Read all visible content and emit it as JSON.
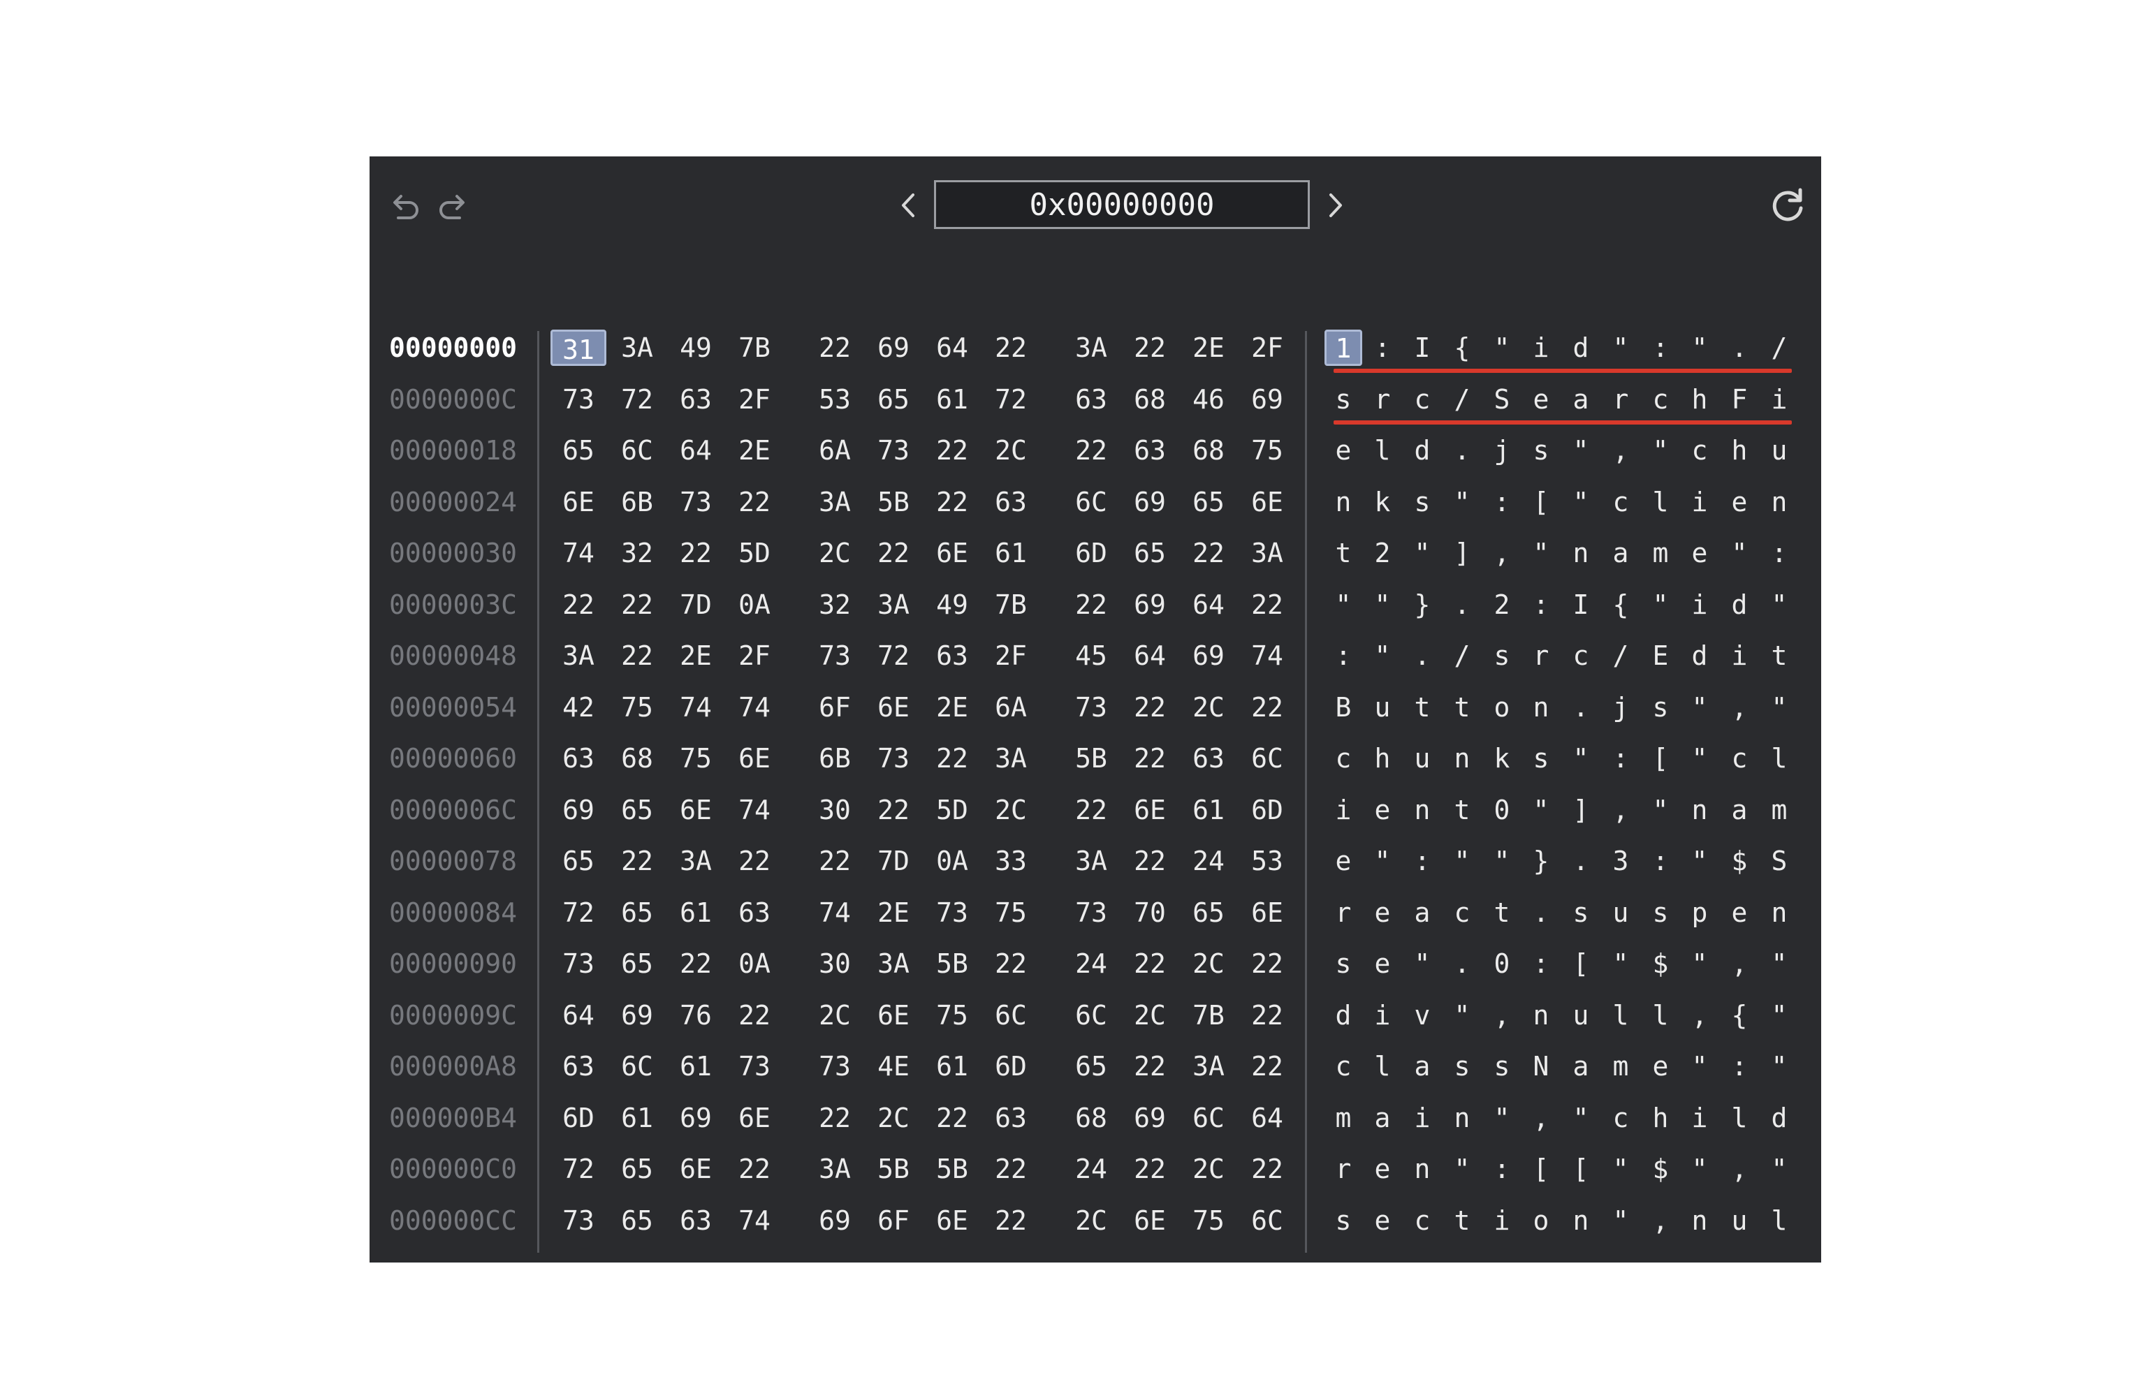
{
  "toolbar": {
    "undo_icon": "undo-icon",
    "redo_icon": "redo-icon",
    "prev_icon": "chevron-left-icon",
    "next_icon": "chevron-right-icon",
    "refresh_icon": "refresh-icon",
    "address": "0x00000000"
  },
  "colors": {
    "panel_bg": "#2a2b2e",
    "selection": "#7d8db0",
    "underline": "#d8392b"
  },
  "selected_byte_index": 0,
  "underlined_text_rows": [
    0,
    1
  ],
  "rows": [
    {
      "offset": "00000000",
      "bytes": [
        "31",
        "3A",
        "49",
        "7B",
        "22",
        "69",
        "64",
        "22",
        "3A",
        "22",
        "2E",
        "2F"
      ],
      "chars": [
        "1",
        ":",
        "I",
        "{",
        "\"",
        "i",
        "d",
        "\"",
        ":",
        "\"",
        ".",
        "/"
      ]
    },
    {
      "offset": "0000000C",
      "bytes": [
        "73",
        "72",
        "63",
        "2F",
        "53",
        "65",
        "61",
        "72",
        "63",
        "68",
        "46",
        "69"
      ],
      "chars": [
        "s",
        "r",
        "c",
        "/",
        "S",
        "e",
        "a",
        "r",
        "c",
        "h",
        "F",
        "i"
      ]
    },
    {
      "offset": "00000018",
      "bytes": [
        "65",
        "6C",
        "64",
        "2E",
        "6A",
        "73",
        "22",
        "2C",
        "22",
        "63",
        "68",
        "75"
      ],
      "chars": [
        "e",
        "l",
        "d",
        ".",
        "j",
        "s",
        "\"",
        ",",
        "\"",
        "c",
        "h",
        "u"
      ]
    },
    {
      "offset": "00000024",
      "bytes": [
        "6E",
        "6B",
        "73",
        "22",
        "3A",
        "5B",
        "22",
        "63",
        "6C",
        "69",
        "65",
        "6E"
      ],
      "chars": [
        "n",
        "k",
        "s",
        "\"",
        ":",
        "[",
        "\"",
        "c",
        "l",
        "i",
        "e",
        "n"
      ]
    },
    {
      "offset": "00000030",
      "bytes": [
        "74",
        "32",
        "22",
        "5D",
        "2C",
        "22",
        "6E",
        "61",
        "6D",
        "65",
        "22",
        "3A"
      ],
      "chars": [
        "t",
        "2",
        "\"",
        "]",
        ",",
        "\"",
        "n",
        "a",
        "m",
        "e",
        "\"",
        ":"
      ]
    },
    {
      "offset": "0000003C",
      "bytes": [
        "22",
        "22",
        "7D",
        "0A",
        "32",
        "3A",
        "49",
        "7B",
        "22",
        "69",
        "64",
        "22"
      ],
      "chars": [
        "\"",
        "\"",
        "}",
        ".",
        "2",
        ":",
        "I",
        "{",
        "\"",
        "i",
        "d",
        "\""
      ]
    },
    {
      "offset": "00000048",
      "bytes": [
        "3A",
        "22",
        "2E",
        "2F",
        "73",
        "72",
        "63",
        "2F",
        "45",
        "64",
        "69",
        "74"
      ],
      "chars": [
        ":",
        "\"",
        ".",
        "/",
        "s",
        "r",
        "c",
        "/",
        "E",
        "d",
        "i",
        "t"
      ]
    },
    {
      "offset": "00000054",
      "bytes": [
        "42",
        "75",
        "74",
        "74",
        "6F",
        "6E",
        "2E",
        "6A",
        "73",
        "22",
        "2C",
        "22"
      ],
      "chars": [
        "B",
        "u",
        "t",
        "t",
        "o",
        "n",
        ".",
        "j",
        "s",
        "\"",
        ",",
        "\""
      ]
    },
    {
      "offset": "00000060",
      "bytes": [
        "63",
        "68",
        "75",
        "6E",
        "6B",
        "73",
        "22",
        "3A",
        "5B",
        "22",
        "63",
        "6C"
      ],
      "chars": [
        "c",
        "h",
        "u",
        "n",
        "k",
        "s",
        "\"",
        ":",
        "[",
        "\"",
        "c",
        "l"
      ]
    },
    {
      "offset": "0000006C",
      "bytes": [
        "69",
        "65",
        "6E",
        "74",
        "30",
        "22",
        "5D",
        "2C",
        "22",
        "6E",
        "61",
        "6D"
      ],
      "chars": [
        "i",
        "e",
        "n",
        "t",
        "0",
        "\"",
        "]",
        ",",
        "\"",
        "n",
        "a",
        "m"
      ]
    },
    {
      "offset": "00000078",
      "bytes": [
        "65",
        "22",
        "3A",
        "22",
        "22",
        "7D",
        "0A",
        "33",
        "3A",
        "22",
        "24",
        "53"
      ],
      "chars": [
        "e",
        "\"",
        ":",
        "\"",
        "\"",
        "}",
        ".",
        "3",
        ":",
        "\"",
        "$",
        "S"
      ]
    },
    {
      "offset": "00000084",
      "bytes": [
        "72",
        "65",
        "61",
        "63",
        "74",
        "2E",
        "73",
        "75",
        "73",
        "70",
        "65",
        "6E"
      ],
      "chars": [
        "r",
        "e",
        "a",
        "c",
        "t",
        ".",
        "s",
        "u",
        "s",
        "p",
        "e",
        "n"
      ]
    },
    {
      "offset": "00000090",
      "bytes": [
        "73",
        "65",
        "22",
        "0A",
        "30",
        "3A",
        "5B",
        "22",
        "24",
        "22",
        "2C",
        "22"
      ],
      "chars": [
        "s",
        "e",
        "\"",
        ".",
        "0",
        ":",
        "[",
        "\"",
        "$",
        "\"",
        ",",
        "\""
      ]
    },
    {
      "offset": "0000009C",
      "bytes": [
        "64",
        "69",
        "76",
        "22",
        "2C",
        "6E",
        "75",
        "6C",
        "6C",
        "2C",
        "7B",
        "22"
      ],
      "chars": [
        "d",
        "i",
        "v",
        "\"",
        ",",
        "n",
        "u",
        "l",
        "l",
        ",",
        "{",
        "\""
      ]
    },
    {
      "offset": "000000A8",
      "bytes": [
        "63",
        "6C",
        "61",
        "73",
        "73",
        "4E",
        "61",
        "6D",
        "65",
        "22",
        "3A",
        "22"
      ],
      "chars": [
        "c",
        "l",
        "a",
        "s",
        "s",
        "N",
        "a",
        "m",
        "e",
        "\"",
        ":",
        "\""
      ]
    },
    {
      "offset": "000000B4",
      "bytes": [
        "6D",
        "61",
        "69",
        "6E",
        "22",
        "2C",
        "22",
        "63",
        "68",
        "69",
        "6C",
        "64"
      ],
      "chars": [
        "m",
        "a",
        "i",
        "n",
        "\"",
        ",",
        "\"",
        "c",
        "h",
        "i",
        "l",
        "d"
      ]
    },
    {
      "offset": "000000C0",
      "bytes": [
        "72",
        "65",
        "6E",
        "22",
        "3A",
        "5B",
        "5B",
        "22",
        "24",
        "22",
        "2C",
        "22"
      ],
      "chars": [
        "r",
        "e",
        "n",
        "\"",
        ":",
        "[",
        "[",
        "\"",
        "$",
        "\"",
        ",",
        "\""
      ]
    },
    {
      "offset": "000000CC",
      "bytes": [
        "73",
        "65",
        "63",
        "74",
        "69",
        "6F",
        "6E",
        "22",
        "2C",
        "6E",
        "75",
        "6C"
      ],
      "chars": [
        "s",
        "e",
        "c",
        "t",
        "i",
        "o",
        "n",
        "\"",
        ",",
        "n",
        "u",
        "l"
      ]
    }
  ]
}
